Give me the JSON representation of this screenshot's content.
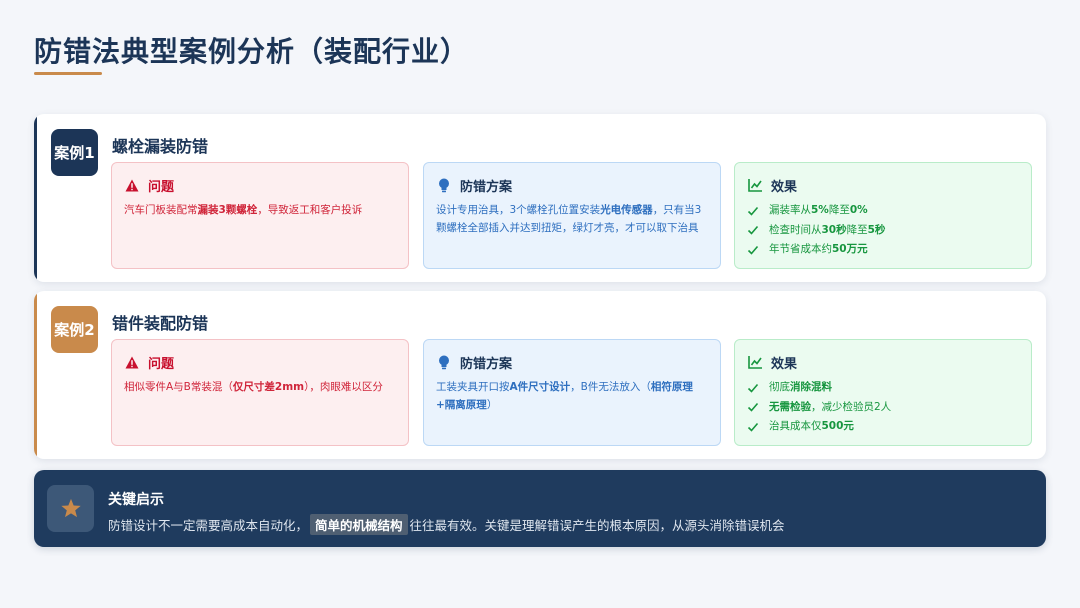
{
  "page": {
    "title": "防错法典型案例分析（装配行业）"
  },
  "colors": {
    "navy": "#1c3557",
    "gold": "#c98a4b",
    "problem": "#c8102e",
    "solution": "#2e6fbf",
    "effect": "#17963f"
  },
  "cases": [
    {
      "badge": "案例1",
      "title": "螺栓漏装防错",
      "problem": {
        "label": "问题",
        "icon": "warning-icon",
        "parts": [
          "汽车门板装配常",
          "漏装3颗螺栓",
          "，导致返工和客户投诉"
        ]
      },
      "solution": {
        "label": "防错方案",
        "icon": "lightbulb-icon",
        "parts": [
          "设计专用治具，3个螺栓孔位置安装",
          "光电传感器",
          "，只有当3颗螺栓全部插入并达到扭矩，绿灯才亮，才可以取下治具"
        ]
      },
      "effect": {
        "label": "效果",
        "icon": "chart-line-icon",
        "items": [
          {
            "pre": "漏装率从",
            "b1": "5%",
            "mid": "降至",
            "b2": "0%",
            "post": ""
          },
          {
            "pre": "检查时间从",
            "b1": "30秒",
            "mid": "降至",
            "b2": "5秒",
            "post": ""
          },
          {
            "pre": "年节省成本约",
            "b1": "50万元",
            "mid": "",
            "b2": "",
            "post": ""
          }
        ]
      }
    },
    {
      "badge": "案例2",
      "title": "错件装配防错",
      "problem": {
        "label": "问题",
        "icon": "warning-icon",
        "parts": [
          "相似零件A与B常装混（",
          "仅尺寸差2mm",
          "），肉眼难以区分"
        ]
      },
      "solution": {
        "label": "防错方案",
        "icon": "lightbulb-icon",
        "parts": [
          "工装夹具开口按",
          "A件尺寸设计",
          "，B件无法放入（",
          "相符原理+隔离原理",
          "）"
        ]
      },
      "effect": {
        "label": "效果",
        "icon": "chart-line-icon",
        "items": [
          {
            "pre": "彻底",
            "b1": "消除混料",
            "mid": "",
            "b2": "",
            "post": ""
          },
          {
            "pre": "",
            "b1": "无需检验",
            "mid": "",
            "b2": "",
            "post": "，减少检验员2人"
          },
          {
            "pre": "治具成本仅",
            "b1": "500元",
            "mid": "",
            "b2": "",
            "post": ""
          }
        ]
      }
    }
  ],
  "insight": {
    "title": "关键启示",
    "icon": "star-icon",
    "text_before": "防错设计不一定需要高成本自动化，",
    "highlight": "简单的机械结构",
    "text_after": "往往最有效。关键是理解错误产生的根本原因，从源头消除错误机会"
  }
}
